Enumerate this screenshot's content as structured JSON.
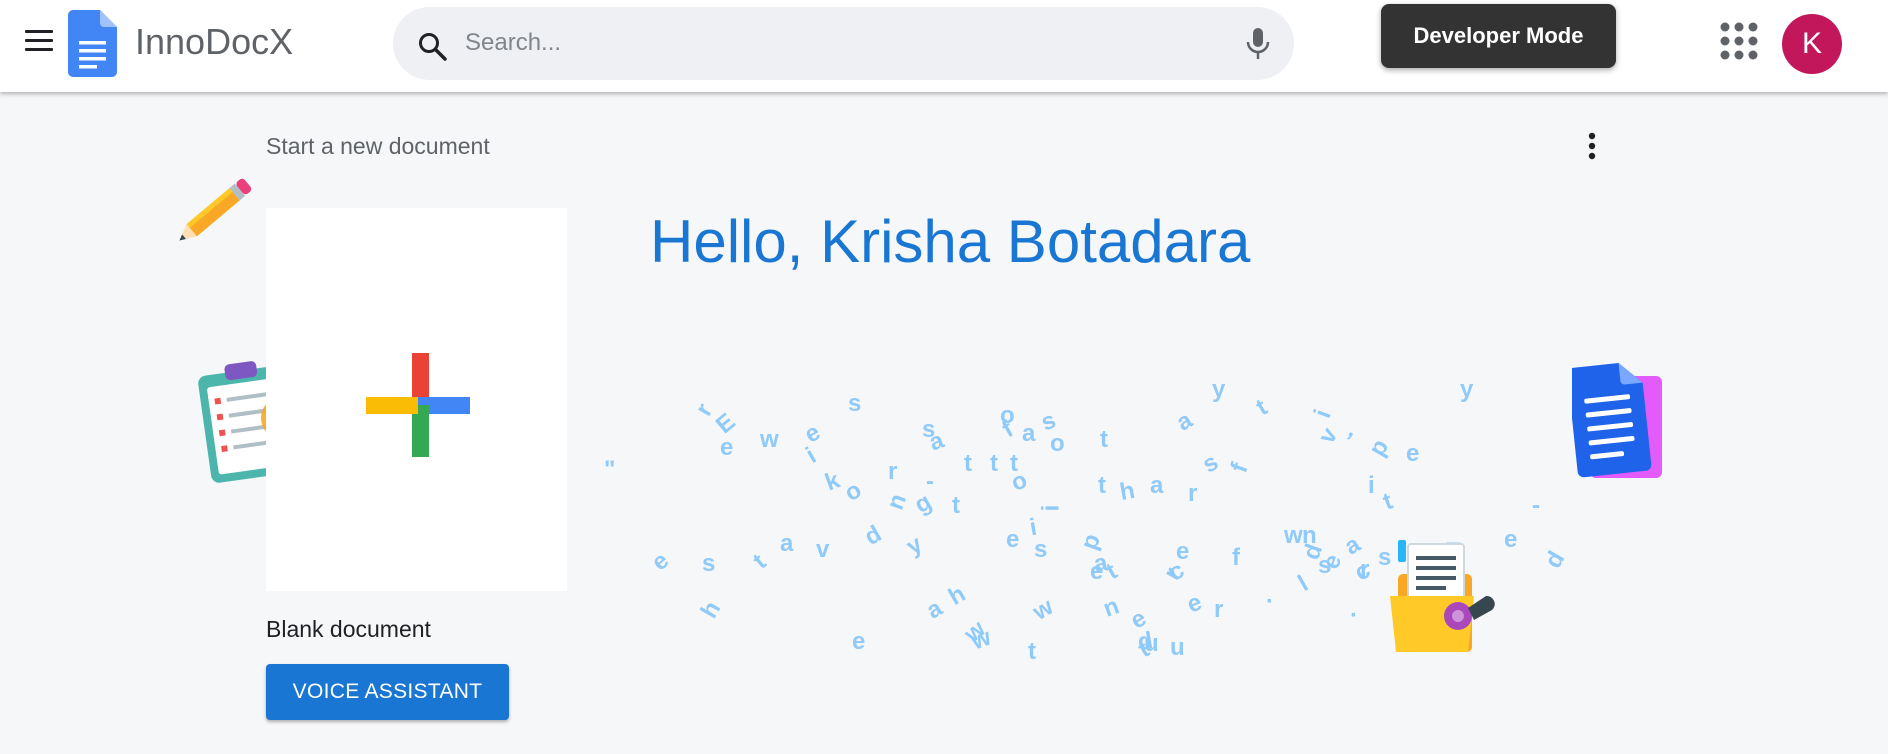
{
  "header": {
    "app_name": "InnoDocX",
    "search_placeholder": "Search...",
    "developer_mode_label": "Developer Mode",
    "avatar_initial": "K"
  },
  "main": {
    "section_title": "Start a new document",
    "blank_document_label": "Blank document",
    "voice_assistant_label": "VOICE ASSISTANT",
    "greeting": "Hello, Krisha Botadara"
  },
  "decorative_letters": [
    "r",
    "E",
    "e",
    "w",
    "e",
    "i",
    "s",
    "s",
    "a",
    "t",
    "t",
    "o",
    "f",
    "a",
    "s",
    "o",
    "t",
    "a",
    "y",
    "t",
    "i",
    "v",
    ",",
    "p",
    "e",
    "y",
    "\"",
    "k",
    "o",
    "r",
    "n",
    "-",
    "g",
    "t",
    "t",
    "o",
    "i",
    "t",
    "h",
    "a",
    "r",
    "s",
    "f",
    "i",
    "t",
    "e",
    "s",
    "t",
    "a",
    "v",
    "d",
    "y",
    "e",
    "i",
    "s",
    "p",
    "e",
    "a",
    "t",
    "c",
    "e",
    "r",
    "f",
    "w",
    "n",
    "a",
    "r",
    "s",
    "l",
    "s",
    "e",
    "c",
    "d",
    "T",
    "e",
    "d",
    "h",
    "a",
    "h",
    "w",
    "e",
    "w",
    "t",
    "w",
    "n",
    "e",
    "d",
    "t",
    "u",
    "e",
    "r",
    "u",
    "-",
    "·",
    "·"
  ],
  "colors": {
    "accent": "#1976d2",
    "avatar": "#c2185b",
    "developer_button": "#333333",
    "letters": "#90caf9",
    "background": "#f6f7f9"
  },
  "icons": [
    "menu-icon",
    "docs-logo-icon",
    "search-icon",
    "mic-icon",
    "apps-grid-icon",
    "more-vert-icon",
    "pencil-icon",
    "clipboard-icon",
    "plus-icon",
    "document-icon",
    "folder-icon"
  ]
}
